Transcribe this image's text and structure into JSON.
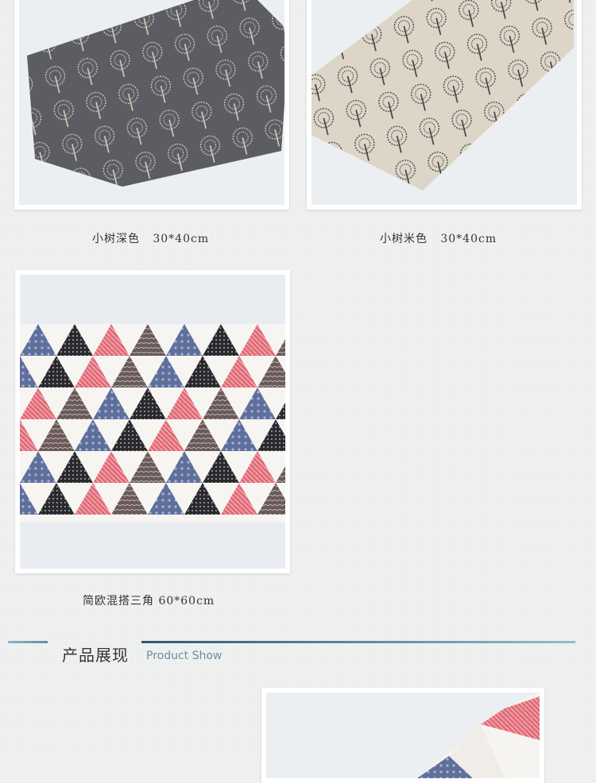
{
  "products": [
    {
      "name": "小树深色   30*40cm"
    },
    {
      "name": "小树米色   30*40cm"
    },
    {
      "name": "简欧混搭三角 60*60cm"
    }
  ],
  "section": {
    "title": "产品展现",
    "subtitle": "Product Show"
  },
  "colors": {
    "dark_mat": "#5b5d62",
    "beige_mat": "#ddd6c8",
    "tri_red": "#e06a75",
    "tri_blue": "#5f6f9c",
    "tri_black": "#2a2a2e",
    "tri_brown": "#6a5a5a",
    "accent_rule": "#2f5872"
  }
}
